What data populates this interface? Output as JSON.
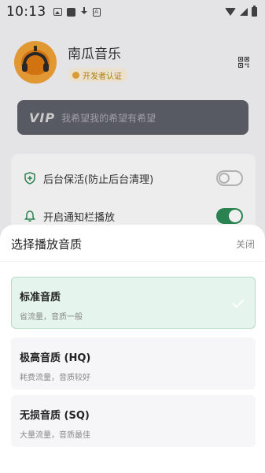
{
  "status_bar": {
    "time": "10:13",
    "a_icon": "A"
  },
  "profile": {
    "app_name": "南瓜音乐",
    "badge": "开发者认证"
  },
  "vip": {
    "logo": "VIP",
    "text": "我希望我的希望有希望"
  },
  "settings": [
    {
      "label": "后台保活(防止后台清理)",
      "icon": "shield-icon",
      "enabled": false
    },
    {
      "label": "开启通知栏播放",
      "icon": "bell-icon",
      "enabled": true
    }
  ],
  "sheet": {
    "title": "选择播放音质",
    "close": "关闭",
    "options": [
      {
        "title": "标准音质",
        "subtitle": "省流量，音质一般",
        "selected": true
      },
      {
        "title": "极高音质 (HQ)",
        "subtitle": "耗费流量，音质较好",
        "selected": false
      },
      {
        "title": "无损音质 (SQ)",
        "subtitle": "大量流量，音质最佳",
        "selected": false
      }
    ]
  },
  "colors": {
    "accent": "#2e8b57",
    "selected_bg": "#e5f4ec",
    "vip_bg": "#5d5f6a",
    "badge_text": "#b8860b"
  }
}
